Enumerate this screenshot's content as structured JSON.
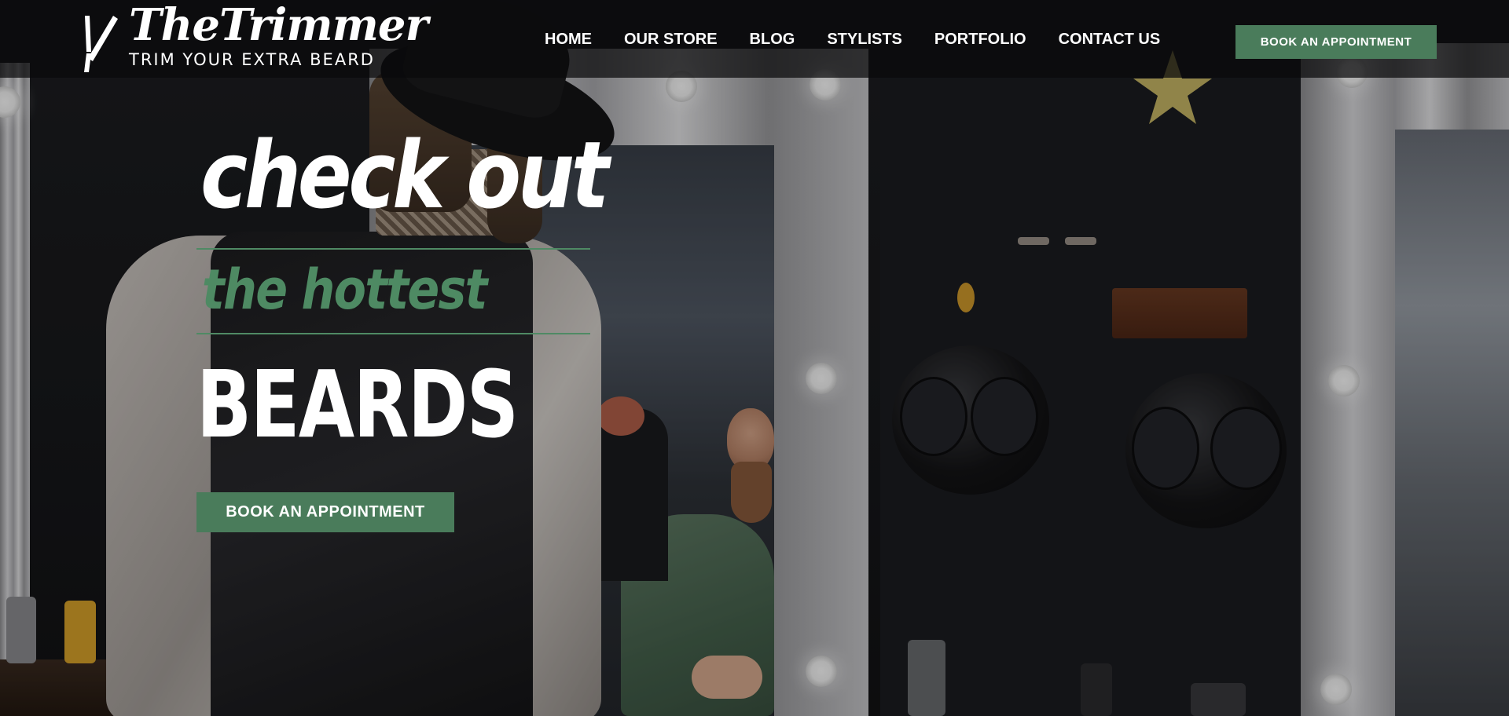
{
  "brand": {
    "name": "TheTrimmer",
    "tagline": "TRIM YOUR EXTRA BEARD"
  },
  "nav": {
    "items": [
      {
        "label": "HOME"
      },
      {
        "label": "OUR STORE"
      },
      {
        "label": "BLOG"
      },
      {
        "label": "STYLISTS"
      },
      {
        "label": "PORTFOLIO"
      },
      {
        "label": "CONTACT US"
      }
    ]
  },
  "header": {
    "cta_label": "BOOK AN APPOINTMENT"
  },
  "hero": {
    "line1": "check out",
    "line2": "the hottest",
    "line3": "BEARDS",
    "cta_label": "BOOK AN APPOINTMENT",
    "background": "barbershop-photo"
  },
  "colors": {
    "accent": "#4a7c5b",
    "header_bg": "#0a0a0b",
    "text": "#ffffff"
  }
}
